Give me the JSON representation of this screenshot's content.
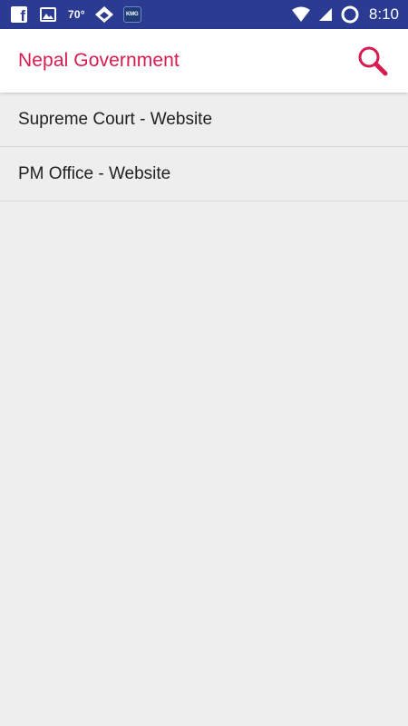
{
  "status_bar": {
    "temperature": "70°",
    "kmg_badge": "KMG",
    "time": "8:10",
    "icons": [
      "facebook-icon",
      "gallery-icon",
      "diamond-app-icon",
      "kmg-app-icon",
      "wifi-icon",
      "cell-signal-icon",
      "sync-icon"
    ],
    "background": "#2b3b92"
  },
  "app_bar": {
    "title": "Nepal Government",
    "title_color": "#d81b4f",
    "search_icon": "search-icon"
  },
  "list": {
    "items": [
      {
        "label": "Supreme Court - Website"
      },
      {
        "label": "PM Office - Website"
      }
    ]
  }
}
